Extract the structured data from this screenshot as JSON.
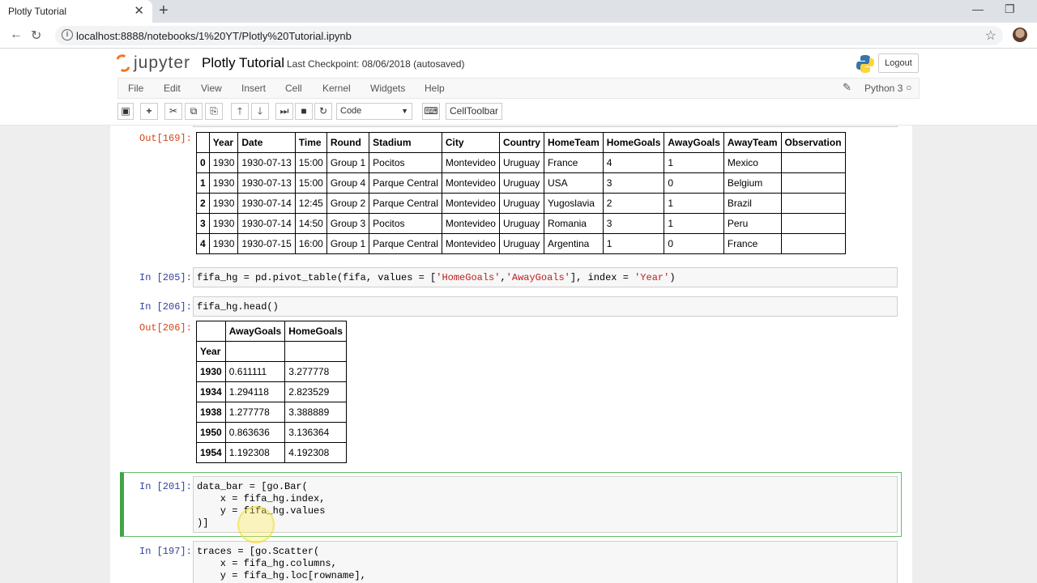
{
  "browser": {
    "tab_title": "Plotly Tutorial",
    "url": "localhost:8888/notebooks/1%20YT/Plotly%20Tutorial.ipynb"
  },
  "jupyter": {
    "logo_text": "jupyter",
    "notebook_name": "Plotly Tutorial",
    "checkpoint": "Last Checkpoint: 08/06/2018 (autosaved)",
    "logout_label": "Logout",
    "kernel_name": "Python 3",
    "menu": [
      "File",
      "Edit",
      "View",
      "Insert",
      "Cell",
      "Kernel",
      "Widgets",
      "Help"
    ],
    "toolbar": {
      "cell_type": "Code",
      "celltoolbar_label": "CellToolbar",
      "icons": [
        "save-icon",
        "plus-icon",
        "cut-icon",
        "copy-icon",
        "paste-icon",
        "arrow-up-icon",
        "arrow-down-icon",
        "run-icon",
        "stop-icon",
        "restart-icon",
        "keyboard-icon"
      ]
    }
  },
  "cells": {
    "out169": {
      "prompt": "Out[169]:",
      "columns": [
        "",
        "Year",
        "Date",
        "Time",
        "Round",
        "Stadium",
        "City",
        "Country",
        "HomeTeam",
        "HomeGoals",
        "AwayGoals",
        "AwayTeam",
        "Observation"
      ],
      "rows": [
        [
          "0",
          "1930",
          "1930-07-13",
          "15:00",
          "Group 1",
          "Pocitos",
          "Montevideo",
          "Uruguay",
          "France",
          "4",
          "1",
          "Mexico",
          ""
        ],
        [
          "1",
          "1930",
          "1930-07-13",
          "15:00",
          "Group 4",
          "Parque Central",
          "Montevideo",
          "Uruguay",
          "USA",
          "3",
          "0",
          "Belgium",
          ""
        ],
        [
          "2",
          "1930",
          "1930-07-14",
          "12:45",
          "Group 2",
          "Parque Central",
          "Montevideo",
          "Uruguay",
          "Yugoslavia",
          "2",
          "1",
          "Brazil",
          ""
        ],
        [
          "3",
          "1930",
          "1930-07-14",
          "14:50",
          "Group 3",
          "Pocitos",
          "Montevideo",
          "Uruguay",
          "Romania",
          "3",
          "1",
          "Peru",
          ""
        ],
        [
          "4",
          "1930",
          "1930-07-15",
          "16:00",
          "Group 1",
          "Parque Central",
          "Montevideo",
          "Uruguay",
          "Argentina",
          "1",
          "0",
          "France",
          ""
        ]
      ]
    },
    "in205": {
      "prompt": "In [205]:",
      "code_pre": "fifa_hg = pd.pivot_table(fifa, values = [",
      "s1": "'HomeGoals'",
      "comma": ",",
      "s2": "'AwayGoals'",
      "code_mid": "], index = ",
      "s3": "'Year'",
      "code_post": ")"
    },
    "in206": {
      "prompt": "In [206]:",
      "code": "fifa_hg.head()"
    },
    "out206": {
      "prompt": "Out[206]:",
      "columns": [
        "",
        "AwayGoals",
        "HomeGoals"
      ],
      "index_name": "Year",
      "rows": [
        [
          "1930",
          "0.611111",
          "3.277778"
        ],
        [
          "1934",
          "1.294118",
          "2.823529"
        ],
        [
          "1938",
          "1.277778",
          "3.388889"
        ],
        [
          "1950",
          "0.863636",
          "3.136364"
        ],
        [
          "1954",
          "1.192308",
          "4.192308"
        ]
      ]
    },
    "in201": {
      "prompt": "In [201]:",
      "code": "data_bar = [go.Bar(\n    x = fifa_hg.index,\n    y = fifa_hg.values\n)]"
    },
    "in197": {
      "prompt": "In [197]:",
      "code": "traces = [go.Scatter(\n    x = fifa_hg.columns,\n    y = fifa_hg.loc[rowname],"
    }
  }
}
